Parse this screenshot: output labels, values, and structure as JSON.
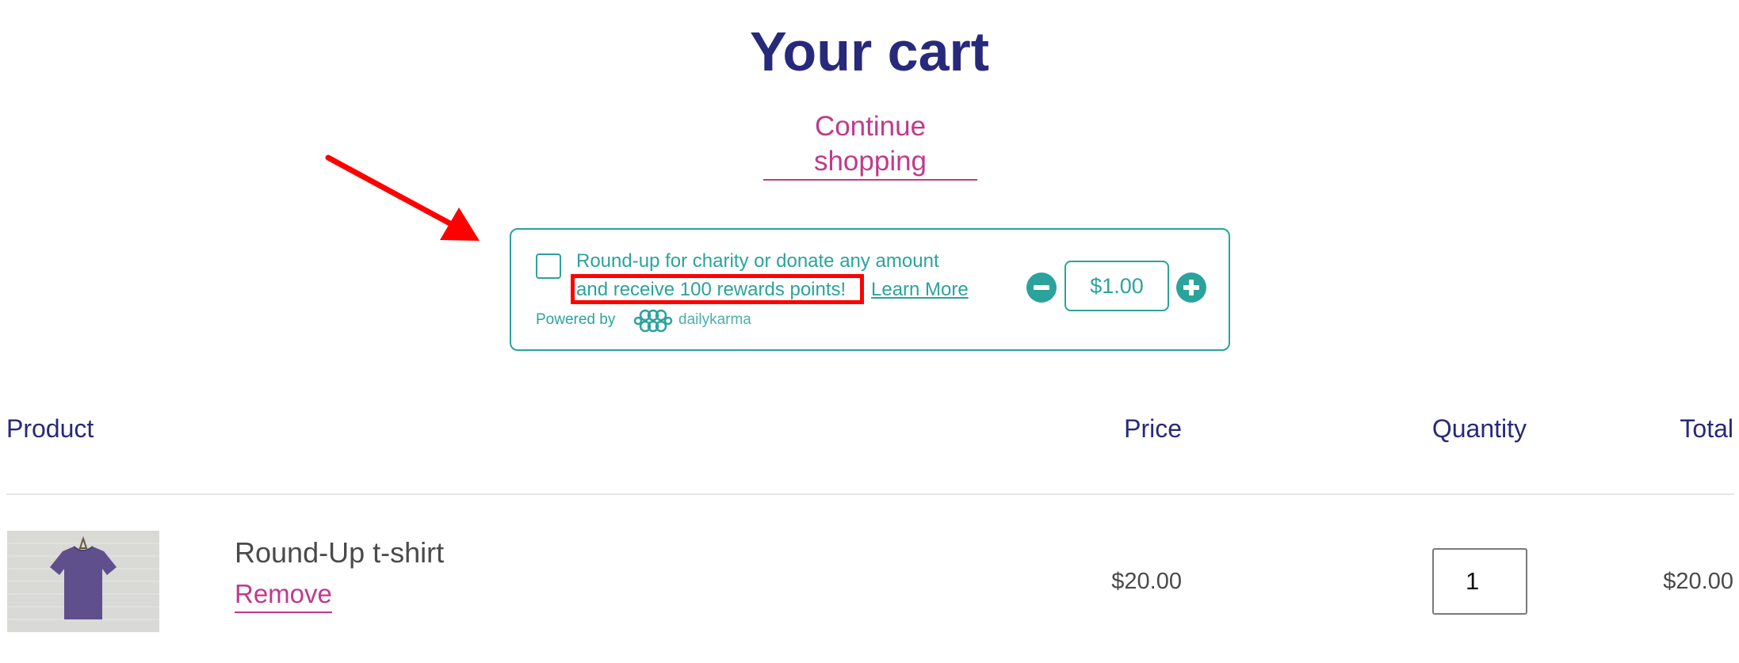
{
  "header": {
    "title": "Your cart",
    "continue_label": "Continue shopping"
  },
  "donation_widget": {
    "message_line1": "Round-up for charity or donate any amount",
    "message_line2": "and receive 100 rewards points!",
    "learn_more_label": "Learn More",
    "powered_by_label": "Powered by",
    "brand_name": "dailykarma",
    "amount": "$1.00",
    "accent_color": "#2ba39c"
  },
  "table": {
    "headers": {
      "product": "Product",
      "price": "Price",
      "quantity": "Quantity",
      "total": "Total"
    },
    "rows": [
      {
        "name": "Round-Up t-shirt",
        "remove_label": "Remove",
        "price": "$20.00",
        "quantity": "1",
        "total": "$20.00",
        "image_icon": "purple-tshirt-thumbnail"
      }
    ]
  },
  "annotation": {
    "arrow_color": "#ff0000",
    "highlight_color": "#ff0000"
  },
  "colors": {
    "heading": "#27297a",
    "link": "#c03a8c",
    "text": "#4a4a4a"
  }
}
